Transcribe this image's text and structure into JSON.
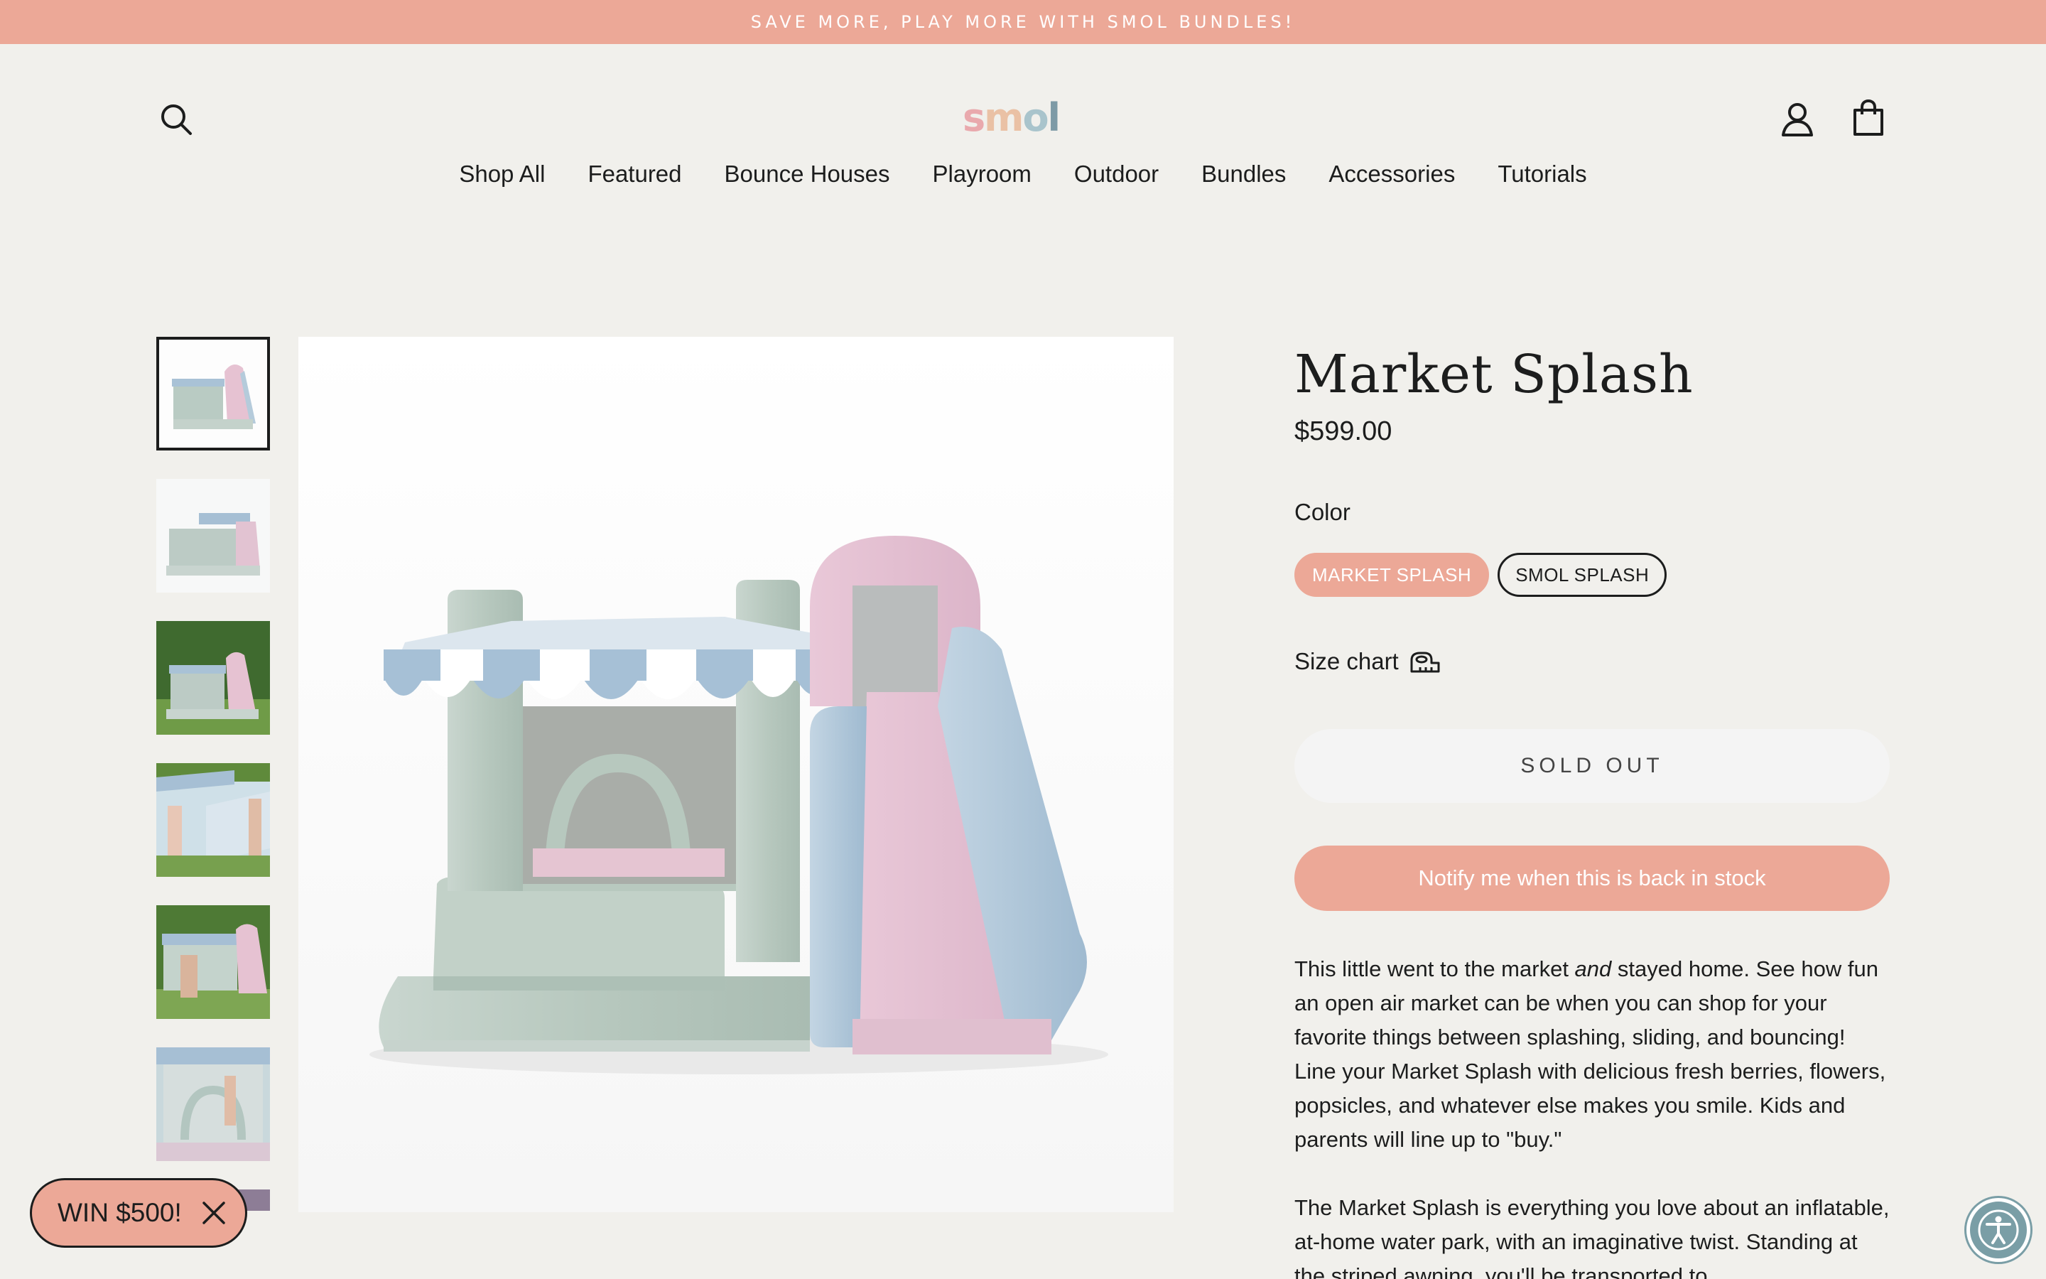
{
  "announcement": {
    "text": "SAVE MORE, PLAY MORE WITH SMOL BUNDLES!"
  },
  "header": {
    "logo": {
      "letters": [
        "s",
        "m",
        "o",
        "l"
      ],
      "colors": [
        "#e9a9ad",
        "#eac1a5",
        "#a9c4cc",
        "#7d9aa6"
      ]
    },
    "icons": {
      "search": "search-icon",
      "account": "account-icon",
      "cart": "cart-icon"
    }
  },
  "nav": {
    "items": [
      "Shop All",
      "Featured",
      "Bounce Houses",
      "Playroom",
      "Outdoor",
      "Bundles",
      "Accessories",
      "Tutorials"
    ]
  },
  "gallery": {
    "thumbnail_count": 7,
    "active_index": 0
  },
  "product": {
    "title": "Market Splash",
    "price": "$599.00",
    "color_label": "Color",
    "colors": [
      "MARKET SPLASH",
      "SMOL SPLASH"
    ],
    "selected_color": "MARKET SPLASH",
    "size_chart_label": "Size chart",
    "sold_out_label": "SOLD OUT",
    "notify_label": "Notify me when this is back in stock",
    "description": {
      "p1_before": "This little went to the market ",
      "p1_em": "and",
      "p1_after": " stayed home. See how fun an open air market can be when you can shop for your favorite things between splashing, sliding, and bouncing! Line your Market Splash with delicious fresh berries, flowers, popsicles, and whatever else makes you smile. Kids and parents will line up to \"buy.\"",
      "p2": "The Market Splash is everything you love about an inflatable, at-home water park, with an imaginative twist. Standing at the striped awning, you'll be transported to"
    }
  },
  "promo": {
    "label": "WIN $500!"
  },
  "colors": {
    "accent": "#eca897",
    "background": "#f1f0ec",
    "text": "#1c1d1d",
    "a11y": "#7a9ea6"
  }
}
